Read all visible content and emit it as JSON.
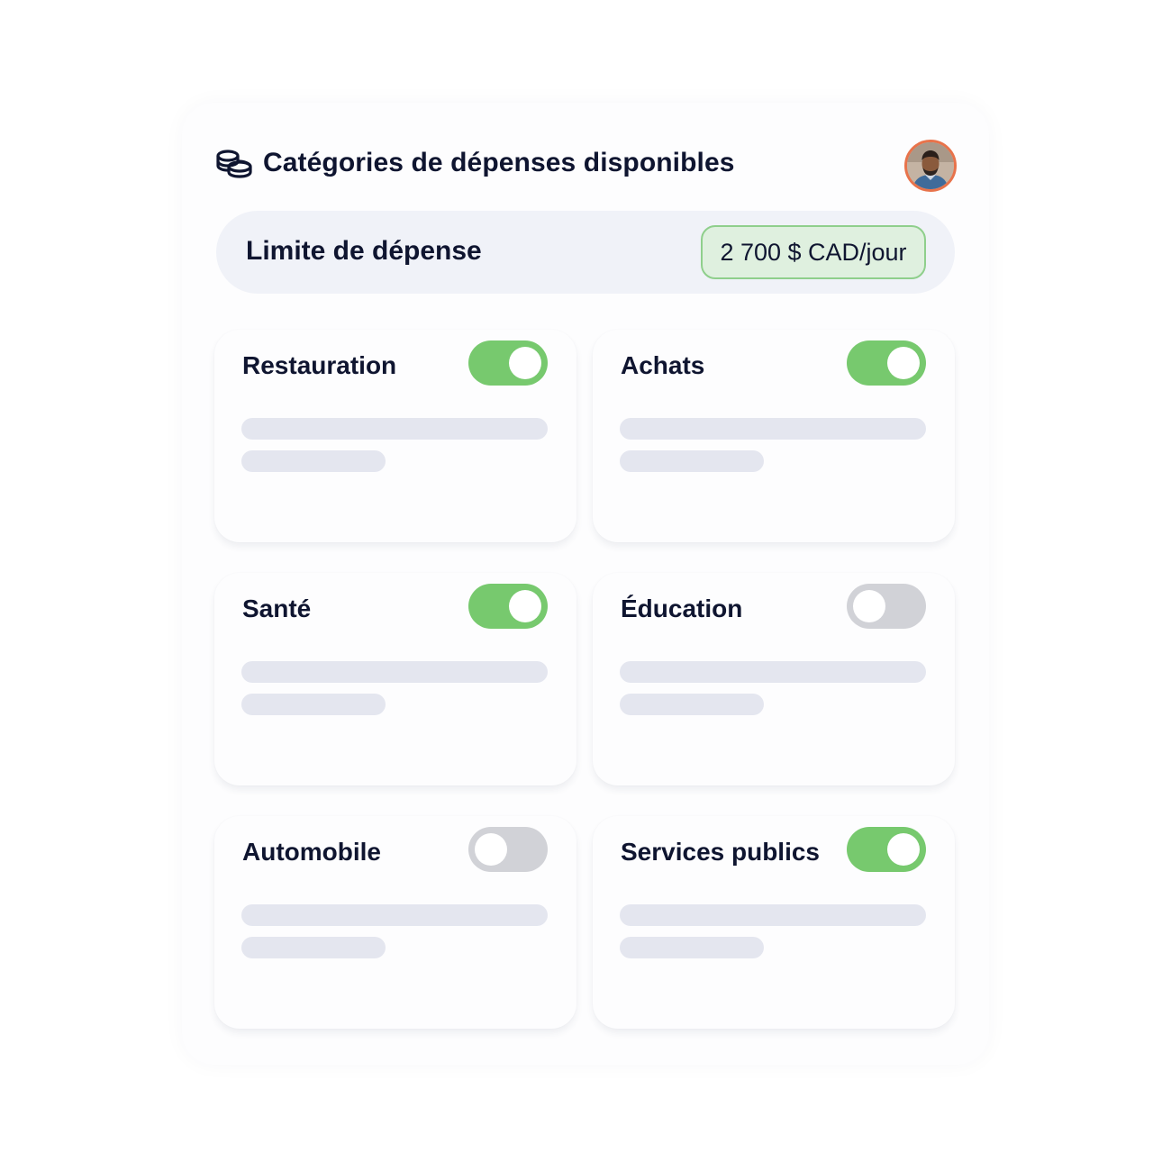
{
  "header": {
    "title": "Catégories de dépenses disponibles",
    "icon": "coins-icon"
  },
  "limit": {
    "label": "Limite de dépense",
    "value": "2 700 $ CAD/jour"
  },
  "colors": {
    "toggle_on": "#77c96e",
    "toggle_off": "#d1d2d7",
    "badge_bg": "#dff0df",
    "badge_border": "#8fcf8c",
    "avatar_ring": "#e8734b"
  },
  "categories": [
    {
      "label": "Restauration",
      "enabled": true
    },
    {
      "label": "Achats",
      "enabled": true
    },
    {
      "label": "Santé",
      "enabled": true
    },
    {
      "label": "Éducation",
      "enabled": false
    },
    {
      "label": "Automobile",
      "enabled": false
    },
    {
      "label": "Services publics",
      "enabled": true
    }
  ]
}
